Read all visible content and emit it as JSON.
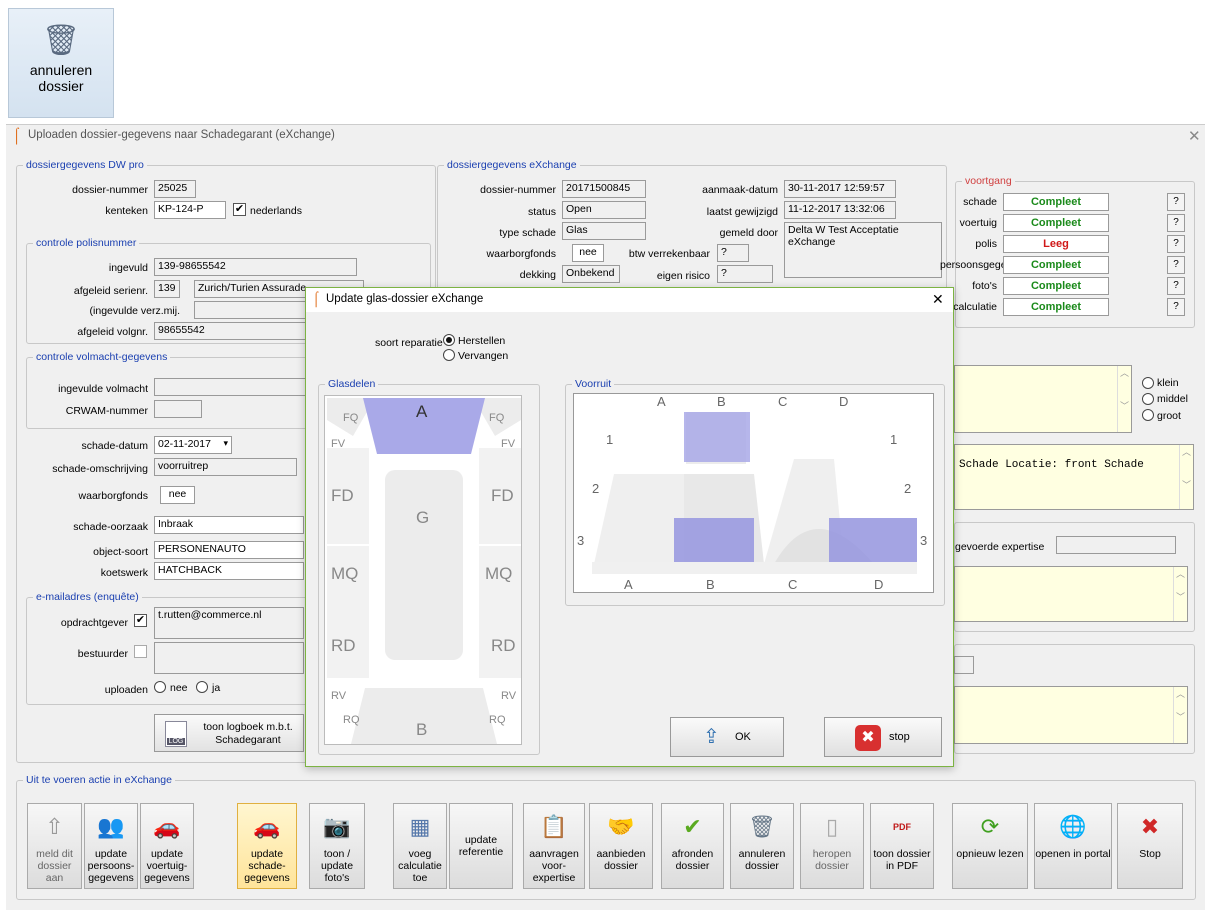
{
  "toolbar_top": {
    "annuleren_label": "annuleren dossier"
  },
  "window": {
    "title": "Uploaden dossier-gegevens naar Schadegarant (eXchange)"
  },
  "dw": {
    "legend": "dossiergegevens DW pro",
    "dossiernummer_label": "dossier-nummer",
    "dossiernummer": "25025",
    "kenteken_label": "kenteken",
    "kenteken": "KP-124-P",
    "nederlands": "nederlands",
    "polis_legend": "controle polisnummer",
    "ingevuld_label": "ingevuld",
    "ingevuld": "139-98655542",
    "serienr_label": "afgeleid serienr.",
    "serienr": "139",
    "verzekeraar": "Zurich/Turien Assurade",
    "verzmij_label": "(ingevulde verz.mij.",
    "volgnr_label": "afgeleid volgnr.",
    "volgnr": "98655542",
    "volmacht_legend": "controle volmacht-gegevens",
    "volmacht_label": "ingevulde volmacht",
    "crwam_label": "CRWAM-nummer",
    "schadedatum_label": "schade-datum",
    "schadedatum": "02-11-2017",
    "omschrijving_label": "schade-omschrijving",
    "omschrijving": "voorruitrep",
    "waarborg_label": "waarborgfonds",
    "waarborg": "nee",
    "oorzaak_label": "schade-oorzaak",
    "oorzaak": "Inbraak",
    "objectsoort_label": "object-soort",
    "objectsoort": "PERSONENAUTO",
    "koetswerk_label": "koetswerk",
    "koetswerk": "HATCHBACK",
    "email_legend": "e-mailadres (enquête)",
    "opdrachtgever_label": "opdrachtgever",
    "opdrachtgever": "t.rutten@commerce.nl",
    "bestuurder_label": "bestuurder",
    "uploaden_label": "uploaden",
    "nee": "nee",
    "ja": "ja",
    "logboek": "toon logboek m.b.t. Schadegarant"
  },
  "ex": {
    "legend": "dossiergegevens eXchange",
    "dossiernummer_label": "dossier-nummer",
    "dossiernummer": "20171500845",
    "status_label": "status",
    "status": "Open",
    "type_label": "type schade",
    "type": "Glas",
    "waarborg_label": "waarborgfonds",
    "waarborg": "nee",
    "btw_label": "btw verrekenbaar",
    "btw": "?",
    "dekking_label": "dekking",
    "dekking": "Onbekend",
    "risico_label": "eigen risico",
    "risico": "?",
    "aanmaak_label": "aanmaak-datum",
    "aanmaak": "30-11-2017 12:59:57",
    "gewijzigd_label": "laatst gewijzigd",
    "gewijzigd": "11-12-2017 13:32:06",
    "gemeld_label": "gemeld door",
    "gemeld": "Delta W Test Acceptatie eXchange"
  },
  "voortgang": {
    "legend": "voortgang",
    "rows": [
      {
        "label": "schade",
        "status": "Compleet",
        "color": "#1a8a1a"
      },
      {
        "label": "voertuig",
        "status": "Compleet",
        "color": "#1a8a1a"
      },
      {
        "label": "polis",
        "status": "Leeg",
        "color": "#d01818"
      },
      {
        "label": "persoonsgegevens",
        "status": "Compleet",
        "color": "#1a8a1a"
      },
      {
        "label": "foto's",
        "status": "Compleet",
        "color": "#1a8a1a"
      },
      {
        "label": "calculatie",
        "status": "Compleet",
        "color": "#1a8a1a"
      }
    ],
    "q": "?"
  },
  "right": {
    "klein": "klein",
    "middel": "middel",
    "groot": "groot",
    "locatie": "Schade Locatie: front Schade",
    "expertise_label": "gevoerde expertise"
  },
  "dialog": {
    "title": "Update glas-dossier eXchange",
    "soort_label": "soort reparatie",
    "herstellen": "Herstellen",
    "vervangen": "Vervangen",
    "glasdelen_legend": "Glasdelen",
    "voorruit_legend": "Voorruit",
    "ok": "OK",
    "stop": "stop",
    "parts": {
      "A": "A",
      "FQ": "FQ",
      "FV": "FV",
      "FD": "FD",
      "G": "G",
      "MQ": "MQ",
      "RD": "RD",
      "RV": "RV",
      "RQ": "RQ",
      "B": "B"
    },
    "grid": {
      "A": "A",
      "B": "B",
      "C": "C",
      "D": "D",
      "r1": "1",
      "r2": "2",
      "r3": "3"
    }
  },
  "actions": {
    "legend": "Uit te voeren actie in eXchange",
    "buttons": [
      {
        "label": "meld dit dossier aan",
        "icon": "⇧",
        "color": "#999999"
      },
      {
        "label": "update persoons-gegevens",
        "icon": "👥",
        "color": "#8a5a2a"
      },
      {
        "label": "update voertuig-gegevens",
        "icon": "🚗",
        "color": "#556688"
      },
      {
        "label": "update schade-gegevens",
        "icon": "🚗",
        "color": "#c02020"
      },
      {
        "label": "toon / update foto's",
        "icon": "📷",
        "color": "#777777"
      },
      {
        "label": "voeg calculatie toe",
        "icon": "▦",
        "color": "#5577aa"
      },
      {
        "label": "update referentie",
        "icon": "",
        "color": "#000000"
      },
      {
        "label": "aanvragen voor-expertise",
        "icon": "📋",
        "color": "#9a8a30"
      },
      {
        "label": "aanbieden dossier",
        "icon": "🤝",
        "color": "#c08030"
      },
      {
        "label": "afronden dossier",
        "icon": "✔",
        "color": "#5aaa20"
      },
      {
        "label": "annuleren dossier",
        "icon": "🗑",
        "color": "#667788"
      },
      {
        "label": "heropen dossier",
        "icon": "▯",
        "color": "#aaaaaa"
      },
      {
        "label": "toon dossier in PDF",
        "icon": "PDF",
        "color": "#c01818"
      },
      {
        "label": "opnieuw lezen",
        "icon": "⟳",
        "color": "#40a020"
      },
      {
        "label": "openen in portal",
        "icon": "🌐",
        "color": "#2070c0"
      },
      {
        "label": "Stop",
        "icon": "✖",
        "color": "#d02828"
      }
    ]
  }
}
